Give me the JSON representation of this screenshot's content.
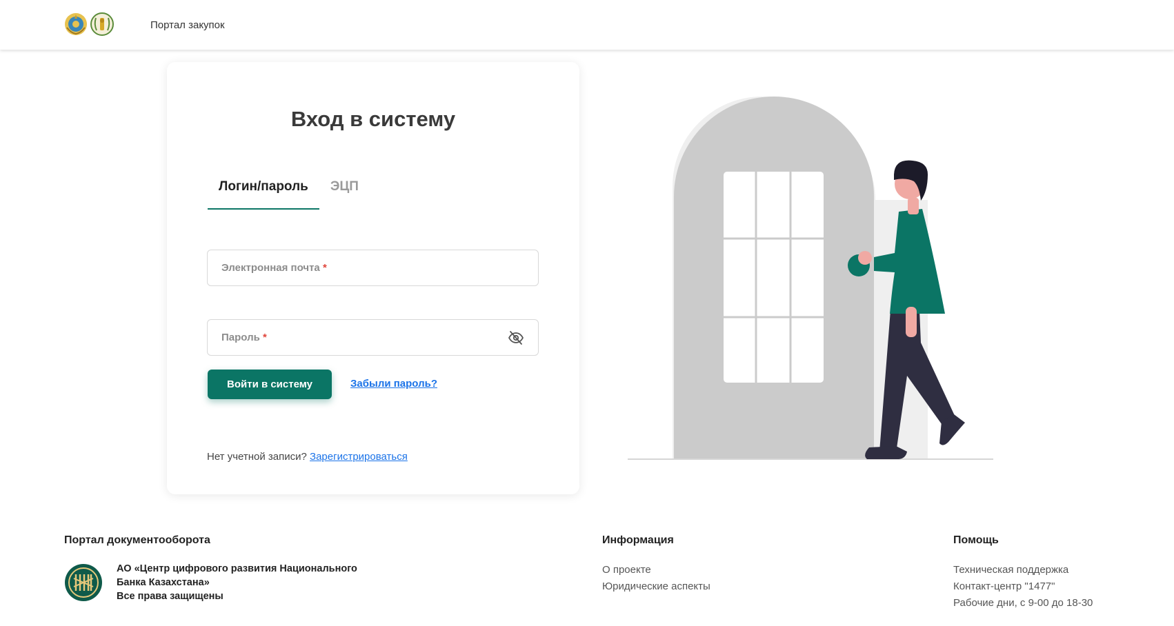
{
  "header": {
    "title": "Портал закупок"
  },
  "login": {
    "title": "Вход в систему",
    "tabs": [
      {
        "label": "Логин/пароль",
        "active": true
      },
      {
        "label": "ЭЦП",
        "active": false
      }
    ],
    "email": {
      "label": "Электронная почта",
      "required_mark": "*",
      "value": ""
    },
    "password": {
      "label": "Пароль",
      "required_mark": "*",
      "value": "",
      "toggle_icon": "eye-off-icon"
    },
    "submit_label": "Войти в систему",
    "forgot_label": "Забыли пароль?",
    "no_account_text": "Нет учетной записи?",
    "register_label": "Зарегистрироваться"
  },
  "footer": {
    "portal": {
      "heading": "Портал документооборота",
      "org_line1": "АО «Центр цифрового развития Национального",
      "org_line2": "Банка Казахстана»",
      "org_line3": "Все права защищены"
    },
    "info": {
      "heading": "Информация",
      "links": [
        "О проекте",
        "Юридические аспекты"
      ]
    },
    "help": {
      "heading": "Помощь",
      "links": [
        "Техническая поддержка",
        "Контакт-центр \"1477\"",
        "Рабочие дни, с 9-00 до 18-30"
      ]
    }
  },
  "colors": {
    "brand": "#0b7565",
    "link": "#1b73e8",
    "required": "#e0463c",
    "door": "#cbcbcb",
    "door_shadow": "#efefef"
  }
}
